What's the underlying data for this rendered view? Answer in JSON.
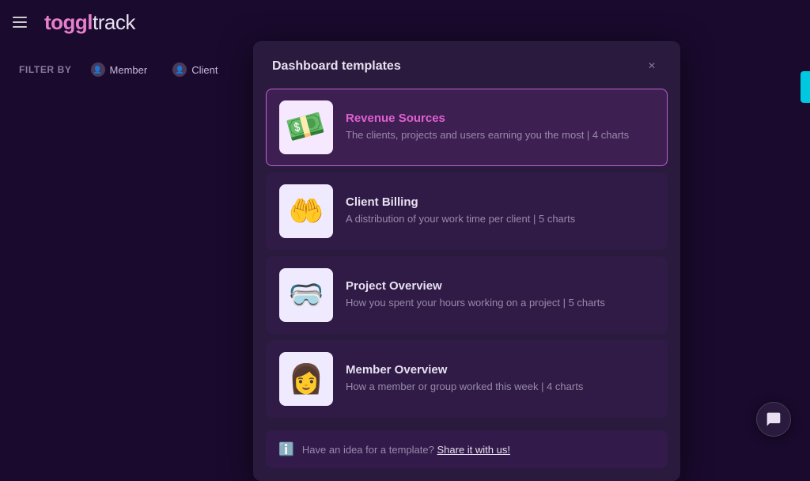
{
  "app": {
    "brand_toggl": "toggl",
    "brand_track": " track"
  },
  "filter_bar": {
    "label": "FILTER BY",
    "buttons": [
      {
        "id": "member",
        "label": "Member"
      },
      {
        "id": "client",
        "label": "Client"
      }
    ]
  },
  "modal": {
    "title": "Dashboard templates",
    "close_label": "×",
    "templates": [
      {
        "id": "revenue-sources",
        "name": "Revenue Sources",
        "description": "The clients, projects and users earning you the most | 4 charts",
        "icon": "💵",
        "selected": true
      },
      {
        "id": "client-billing",
        "name": "Client Billing",
        "description": "A distribution of your work time per client | 5 charts",
        "icon": "🤲",
        "selected": false
      },
      {
        "id": "project-overview",
        "name": "Project Overview",
        "description": "How you spent your hours working on a project | 5 charts",
        "icon": "🥽",
        "selected": false
      },
      {
        "id": "member-overview",
        "name": "Member Overview",
        "description": "How a member or group worked this week | 4 charts",
        "icon": "👩",
        "selected": false
      }
    ],
    "footer": {
      "hint": "Have an idea for a template?",
      "link_text": "Share it with us!"
    }
  }
}
